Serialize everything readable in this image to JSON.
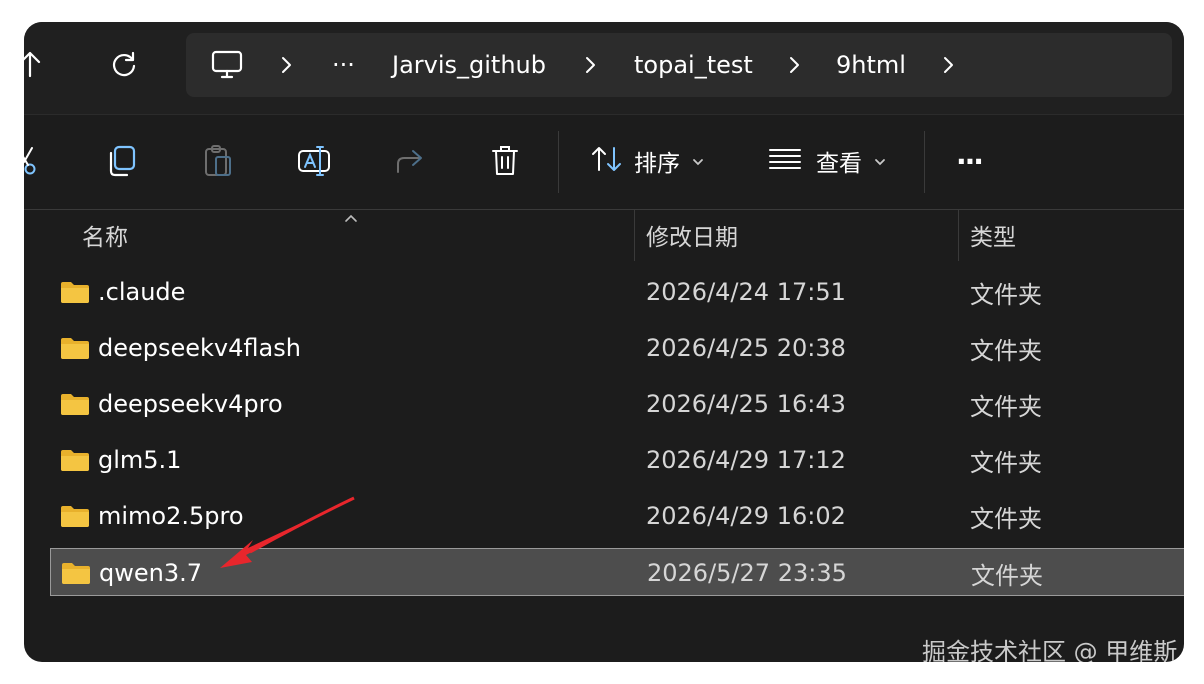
{
  "navigation": {
    "up_icon": "arrow-up-icon",
    "refresh_icon": "refresh-icon",
    "breadcrumb": {
      "root_icon": "computer-icon",
      "overflow": "···",
      "items": [
        "Jarvis_github",
        "topai_test",
        "9html"
      ]
    }
  },
  "command_bar": {
    "cut_icon": "cut-icon",
    "copy_icon": "copy-icon",
    "paste_icon": "paste-icon",
    "rename_icon": "rename-icon",
    "share_icon": "share-icon",
    "delete_icon": "delete-icon",
    "sort_label": "排序",
    "view_label": "查看",
    "more_label": "···"
  },
  "columns": {
    "name": "名称",
    "modified": "修改日期",
    "type": "类型"
  },
  "files": [
    {
      "name": ".claude",
      "modified": "2026/4/24 17:51",
      "type": "文件夹",
      "selected": false
    },
    {
      "name": "deepseekv4flash",
      "modified": "2026/4/25 20:38",
      "type": "文件夹",
      "selected": false
    },
    {
      "name": "deepseekv4pro",
      "modified": "2026/4/25 16:43",
      "type": "文件夹",
      "selected": false
    },
    {
      "name": "glm5.1",
      "modified": "2026/4/29 17:12",
      "type": "文件夹",
      "selected": false
    },
    {
      "name": "mimo2.5pro",
      "modified": "2026/4/29 16:02",
      "type": "文件夹",
      "selected": false
    },
    {
      "name": "qwen3.7",
      "modified": "2026/5/27 23:35",
      "type": "文件夹",
      "selected": true
    }
  ],
  "watermark": "掘金技术社区 @ 甲维斯",
  "colors": {
    "background": "#1c1c1c",
    "selection": "#4d4d4d",
    "folder": "#f4c542",
    "annotation_arrow": "#e8262c"
  }
}
